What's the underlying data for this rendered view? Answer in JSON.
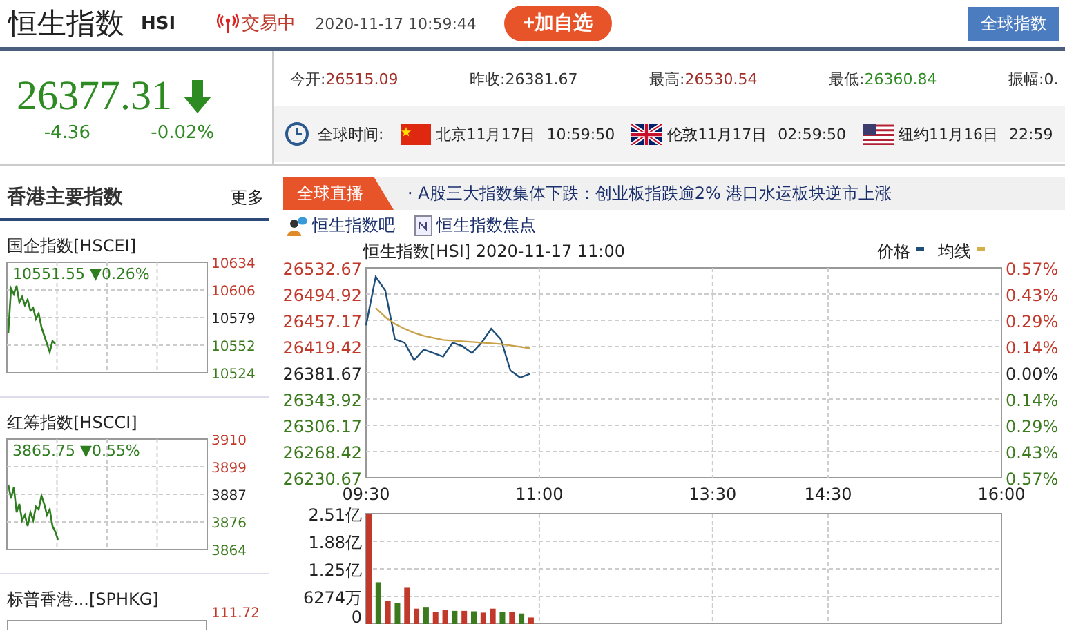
{
  "header": {
    "title": "恒生指数",
    "code": "HSI",
    "status": "交易中",
    "datetime": "2020-11-17 10:59:44",
    "add_button": "+加自选",
    "global_button": "全球指数"
  },
  "quote": {
    "price": "26377.31",
    "falling": true,
    "change": "-4.36",
    "change_pct": "-0.02%"
  },
  "stats": [
    {
      "label": "今开:",
      "value": "26515.09",
      "color": "#a0302a"
    },
    {
      "label": "昨收:",
      "value": "26381.67",
      "color": "#333333"
    },
    {
      "label": "最高:",
      "value": "26530.54",
      "color": "#a0302a"
    },
    {
      "label": "最低:",
      "value": "26360.84",
      "color": "#2e8b22"
    },
    {
      "label": "振幅:",
      "value": "0.",
      "color": "#333333"
    }
  ],
  "world_time": {
    "label": "全球时间:",
    "cities": [
      {
        "kind": "cn",
        "place": "北京11月17日",
        "time": "10:59:50"
      },
      {
        "kind": "uk",
        "place": "伦敦11月17日",
        "time": "02:59:50"
      },
      {
        "kind": "us",
        "place": "纽约11月16日",
        "time": "22:59"
      }
    ]
  },
  "sidebar": {
    "title": "香港主要指数",
    "more": "更多",
    "indices": [
      {
        "name": "国企指数[HSCEI]",
        "quote": "10551.55 ▼0.26%",
        "scale_labels": [
          "10634",
          "10606",
          "10579",
          "10552",
          "10524"
        ]
      },
      {
        "name": "红筹指数[HSCCI]",
        "quote": "3865.75 ▼0.55%",
        "scale_labels": [
          "3910",
          "3899",
          "3887",
          "3876",
          "3864"
        ]
      },
      {
        "name": "标普香港...[SPHKG]",
        "scale_labels": [
          "111.72"
        ]
      }
    ]
  },
  "news": {
    "tab": "全球直播",
    "headline": "· A股三大指数集体下跌：创业板指跌逾2% 港口水运板块逆市上涨"
  },
  "links": [
    {
      "kind": "forum",
      "label": "恒生指数吧"
    },
    {
      "kind": "news",
      "label": "恒生指数焦点"
    }
  ],
  "price_chart": {
    "title": "恒生指数[HSI] 2020-11-17 11:00",
    "legend": [
      {
        "label": "价格",
        "color": "#1f4e79"
      },
      {
        "label": "均线",
        "color": "#d4b04a"
      }
    ],
    "right_axis_labels": [
      "0.57%",
      "0.43%",
      "0.29%",
      "0.14%",
      "0.00%",
      "0.14%",
      "0.29%",
      "0.43%",
      "0.57%"
    ],
    "chart_data": {
      "type": "line",
      "grid": true,
      "ylim": [
        26230.67,
        26532.67
      ],
      "yticks": [
        {
          "value": 26532.67,
          "label": "26532.67"
        },
        {
          "value": 26494.92,
          "label": "26494.92"
        },
        {
          "value": 26457.17,
          "label": "26457.17"
        },
        {
          "value": 26419.42,
          "label": "26419.42"
        },
        {
          "value": 26381.67,
          "label": "26381.67"
        },
        {
          "value": 26343.92,
          "label": "26343.92"
        },
        {
          "value": 26306.17,
          "label": "26306.17"
        },
        {
          "value": 26268.42,
          "label": "26268.42"
        },
        {
          "value": 26230.67,
          "label": "26230.67"
        }
      ],
      "categories": [
        "09:30",
        null,
        null,
        null,
        null,
        null,
        null,
        null,
        null,
        null,
        null,
        null,
        null,
        null,
        null,
        null,
        null,
        null,
        "11:00",
        null,
        null,
        null,
        null,
        null,
        null,
        null,
        null,
        null,
        null,
        null,
        null,
        null,
        null,
        null,
        null,
        null,
        "13:30",
        null,
        null,
        null,
        null,
        null,
        null,
        null,
        null,
        null,
        null,
        null,
        "14:30",
        null,
        null,
        null,
        null,
        null,
        null,
        null,
        null,
        null,
        null,
        null,
        null,
        null,
        null,
        null,
        null,
        null,
        "16:00"
      ],
      "series": [
        {
          "color": "#1f4e79",
          "values": [
            26450,
            26520,
            26500,
            26430,
            26425,
            26400,
            26415,
            26410,
            26405,
            26425,
            26420,
            26410,
            26425,
            26445,
            26430,
            26385,
            26375,
            26380,
            null,
            null,
            null,
            null,
            null,
            null,
            null,
            null,
            null,
            null,
            null,
            null,
            null,
            null,
            null,
            null,
            null,
            null,
            null,
            null,
            null,
            null,
            null,
            null,
            null,
            null,
            null,
            null,
            null,
            null,
            null,
            null,
            null,
            null,
            null,
            null,
            null,
            null,
            null,
            null,
            null,
            null,
            null,
            null,
            null,
            null,
            null,
            null,
            null
          ]
        },
        {
          "color": "#c8a24a",
          "values": [
            null,
            26475,
            26462,
            26452,
            26445,
            26439,
            26435,
            26432,
            26429,
            26428,
            26427,
            26426,
            26425,
            26424,
            26423,
            26421,
            26419,
            26417,
            null,
            null,
            null,
            null,
            null,
            null,
            null,
            null,
            null,
            null,
            null,
            null,
            null,
            null,
            null,
            null,
            null,
            null,
            null,
            null,
            null,
            null,
            null,
            null,
            null,
            null,
            null,
            null,
            null,
            null,
            null,
            null,
            null,
            null,
            null,
            null,
            null,
            null,
            null,
            null,
            null,
            null,
            null,
            null,
            null,
            null,
            null,
            null,
            null
          ]
        }
      ]
    }
  },
  "volume_chart": {
    "quarter_label": "6274万",
    "chart_data": {
      "type": "bar",
      "stacked": true,
      "grid": true,
      "ylim": [
        0,
        2.51
      ],
      "yticks": [
        {
          "value": 0,
          "label": "0"
        },
        {
          "value": 1.25,
          "label": "1.25亿"
        },
        {
          "value": 1.88,
          "label": "1.88亿"
        },
        {
          "value": 2.51,
          "label": "2.51亿"
        }
      ],
      "categories": [
        null,
        null,
        null,
        null,
        null,
        null,
        null,
        null,
        null,
        null,
        null,
        null,
        null,
        null,
        null,
        null,
        null,
        null,
        null,
        null,
        null,
        null,
        null,
        null,
        null,
        null,
        null,
        null,
        null,
        null,
        null,
        null,
        null,
        null,
        null,
        null,
        null,
        null,
        null,
        null,
        null,
        null,
        null,
        null,
        null,
        null,
        null,
        null,
        null,
        null,
        null,
        null,
        null,
        null,
        null,
        null,
        null,
        null,
        null,
        null,
        null,
        null,
        null,
        null,
        null,
        null,
        null
      ],
      "series": [
        {
          "color": "#c0392b",
          "values": [
            2.51,
            null,
            0.52,
            null,
            0.84,
            0.35,
            null,
            0.28,
            0.32,
            null,
            0.3,
            null,
            0.26,
            0.35,
            null,
            0.28,
            null,
            0.15,
            null,
            null,
            null,
            null,
            null,
            null,
            null,
            null,
            null,
            null,
            null,
            null,
            null,
            null,
            null,
            null,
            null,
            null,
            null,
            null,
            null,
            null,
            null,
            null,
            null,
            null,
            null,
            null,
            null,
            null,
            null,
            null,
            null,
            null,
            null,
            null,
            null,
            null,
            null,
            null,
            null,
            null,
            null,
            null,
            null,
            null,
            null,
            null,
            null
          ]
        },
        {
          "color": "#3c7a1e",
          "values": [
            null,
            0.95,
            null,
            0.48,
            null,
            null,
            0.39,
            null,
            null,
            0.3,
            null,
            0.29,
            null,
            null,
            0.27,
            null,
            0.24,
            null,
            null,
            null,
            null,
            null,
            null,
            null,
            null,
            null,
            null,
            null,
            null,
            null,
            null,
            null,
            null,
            null,
            null,
            null,
            null,
            null,
            null,
            null,
            null,
            null,
            null,
            null,
            null,
            null,
            null,
            null,
            null,
            null,
            null,
            null,
            null,
            null,
            null,
            null,
            null,
            null,
            null,
            null,
            null,
            null,
            null,
            null,
            null,
            null,
            null
          ]
        }
      ]
    }
  }
}
